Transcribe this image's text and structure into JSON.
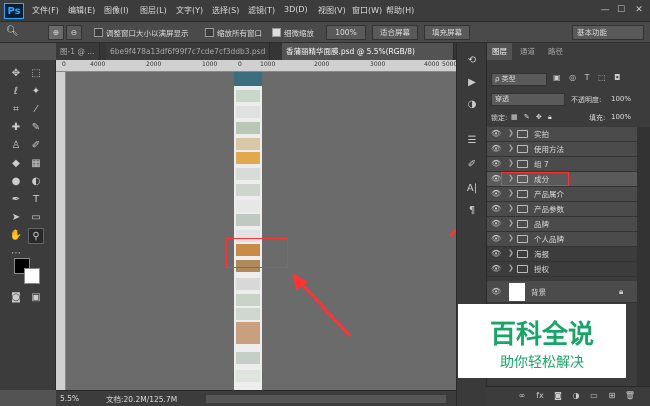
{
  "menubar": {
    "logo": "Ps",
    "items": [
      "文件(F)",
      "编辑(E)",
      "图像(I)",
      "图层(L)",
      "文字(Y)",
      "选择(S)",
      "滤镜(T)",
      "3D(D)",
      "视图(V)",
      "窗口(W)",
      "帮助(H)"
    ],
    "minimize": "—",
    "maximize": "☐",
    "close": "✕"
  },
  "options": {
    "resize_window": "调整窗口大小以满屏显示",
    "zoom_all": "缩放所有窗口",
    "scrubby_zoom": "细微缩放",
    "zoom_value": "100%",
    "fit_screen": "适合屏幕",
    "fill_screen": "填充屏幕",
    "workspace": "基本功能"
  },
  "tabs": [
    {
      "label": "图-1 @ ..."
    },
    {
      "label": "6be9f478a13df6f99f7c7cde7cf3ddb3.psd"
    },
    {
      "label": "香蒲丽精华面膜.psd @ 5.5%(RGB/8)"
    }
  ],
  "ruler": {
    "top": [
      "0",
      "4000",
      "2000",
      "1000",
      "0",
      "1000",
      "2000",
      "3000",
      "4000",
      "5000"
    ]
  },
  "status": {
    "zoom": "5.5%",
    "doc": "文档:20.2M/125.7M"
  },
  "layers_panel": {
    "tabs": [
      "图层",
      "通道",
      "路径"
    ],
    "filter": "ρ 类型",
    "blend": "穿透",
    "opacity_label": "不透明度:",
    "opacity": "100%",
    "lock_label": "锁定:",
    "fill_label": "填充:",
    "fill": "100%",
    "layers": [
      {
        "name": "实拍"
      },
      {
        "name": "使用方法"
      },
      {
        "name": "组 7"
      },
      {
        "name": "成分"
      },
      {
        "name": "产品属介"
      },
      {
        "name": "产品参数"
      },
      {
        "name": "品牌"
      },
      {
        "name": "个人品牌"
      },
      {
        "name": "海报"
      },
      {
        "name": "授权"
      }
    ],
    "background": "背景"
  },
  "watermark": {
    "title": "百科全说",
    "subtitle": "助你轻松解决"
  },
  "colors": {
    "accent": "#ff3333",
    "watermark": "#1aa568"
  }
}
